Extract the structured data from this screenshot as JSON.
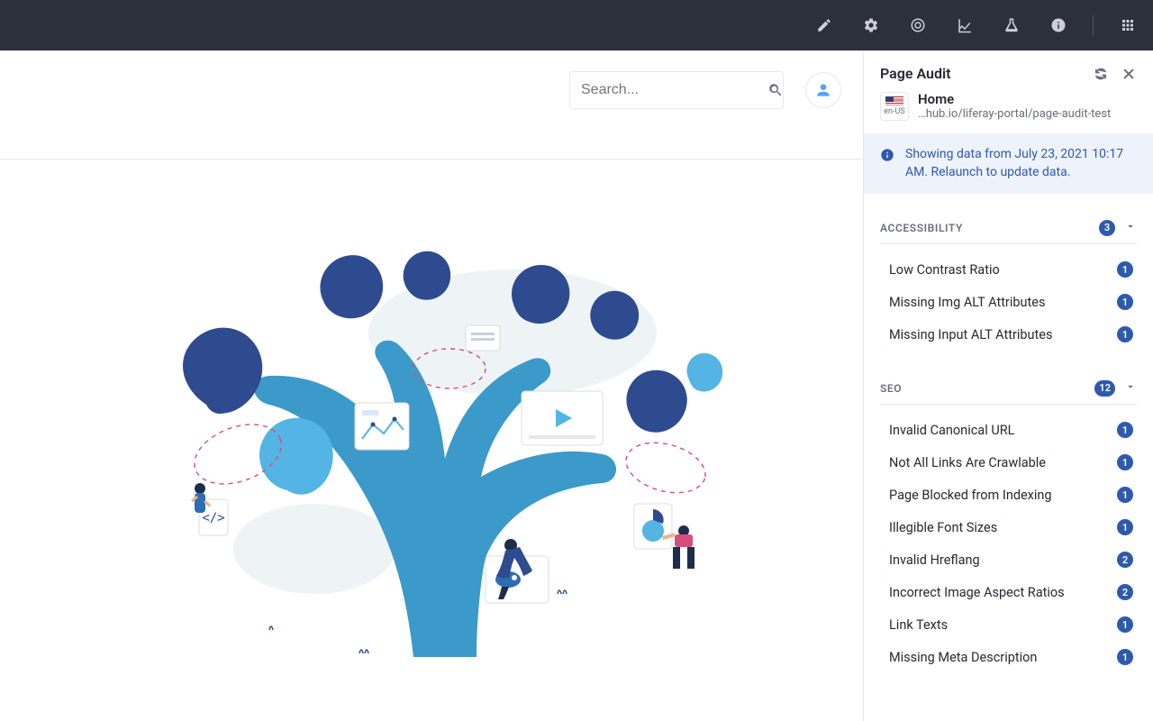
{
  "topbar": {
    "icons": [
      "pencil-icon",
      "gear-icon",
      "target-icon",
      "chart-icon",
      "flask-icon",
      "info-icon",
      "grid-icon"
    ]
  },
  "search": {
    "placeholder": "Search..."
  },
  "panel": {
    "title": "Page Audit",
    "lang": "en-US",
    "page_title": "Home",
    "page_url": "…hub.io/liferay-portal/page-audit-test",
    "info": "Showing data from July 23, 2021 10:17 AM. Relaunch to update data."
  },
  "sections": [
    {
      "label": "ACCESSIBILITY",
      "total": "3",
      "items": [
        {
          "label": "Low Contrast Ratio",
          "count": "1"
        },
        {
          "label": "Missing Img ALT Attributes",
          "count": "1"
        },
        {
          "label": "Missing Input ALT Attributes",
          "count": "1"
        }
      ]
    },
    {
      "label": "SEO",
      "total": "12",
      "items": [
        {
          "label": "Invalid Canonical URL",
          "count": "1"
        },
        {
          "label": "Not All Links Are Crawlable",
          "count": "1"
        },
        {
          "label": "Page Blocked from Indexing",
          "count": "1"
        },
        {
          "label": "Illegible Font Sizes",
          "count": "1"
        },
        {
          "label": "Invalid Hreflang",
          "count": "2"
        },
        {
          "label": "Incorrect Image Aspect Ratios",
          "count": "2"
        },
        {
          "label": "Link Texts",
          "count": "1"
        },
        {
          "label": "Missing Meta Description",
          "count": "1"
        }
      ]
    }
  ]
}
